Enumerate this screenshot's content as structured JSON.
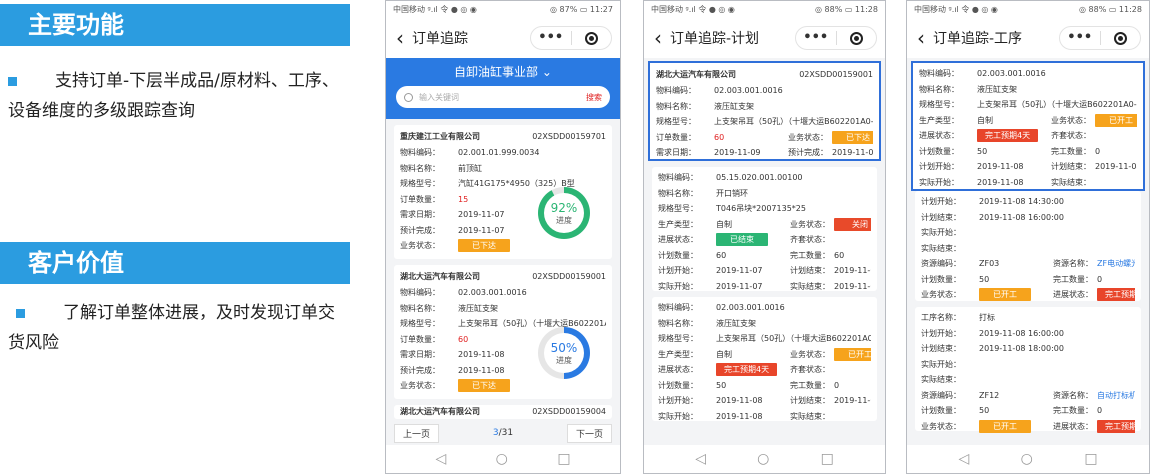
{
  "slide": {
    "title1": "主要功能",
    "text1": "支持订单-下层半成品/原材料、工序、设备维度的多级跟踪查询",
    "title2": "客户价值",
    "text2": "了解订单整体进展，及时发现订单交货风险"
  },
  "statusbar": {
    "carrier": "中国移动 ᵍ.ıl 令 ● ◎ ◉",
    "battery1": "◎ 87% ▭ 11:27",
    "battery2": "◎ 88% ▭ 11:28",
    "battery3": "◎ 88% ▭ 11:28"
  },
  "phone1": {
    "title": "订单追踪",
    "dept": "自卸油缸事业部",
    "search_placeholder": "输入关键词",
    "search_btn": "搜索",
    "cards": [
      {
        "company": "重庆建江工业有限公司",
        "code": "02XSDD00159701",
        "rows": [
          [
            "物料编码：",
            "02.001.01.999.0034"
          ],
          [
            "物料名称：",
            "前顶缸"
          ],
          [
            "规格型号：",
            "汽缸41G175*4950（325）B型"
          ],
          [
            "订单数量：",
            "15"
          ],
          [
            "需求日期：",
            "2019-11-07"
          ],
          [
            "预计完成：",
            "2019-11-07"
          ],
          [
            "业务状态：",
            "已下达"
          ]
        ],
        "pct": "92%",
        "pct_value": 92,
        "lbl": "进度",
        "color": "#2bb574"
      },
      {
        "company": "湖北大运汽车有限公司",
        "code": "02XSDD00159001",
        "rows": [
          [
            "物料编码：",
            "02.003.001.0016"
          ],
          [
            "物料名称：",
            "液压缸支架"
          ],
          [
            "规格型号：",
            "上支架吊耳（50孔）（十堰大运B602201A0-"
          ],
          [
            "订单数量：",
            "60"
          ],
          [
            "需求日期：",
            "2019-11-08"
          ],
          [
            "预计完成：",
            "2019-11-08"
          ],
          [
            "业务状态：",
            "已下达"
          ]
        ],
        "pct": "50%",
        "pct_value": 50,
        "lbl": "进度",
        "color": "#2a7ae2"
      }
    ],
    "card3_company": "湖北大运汽车有限公司",
    "card3_code": "02XSDD00159004",
    "prev": "上一页",
    "page_cur": "3",
    "page_total": "/31",
    "next": "下一页"
  },
  "phone2": {
    "title": "订单追踪-计划",
    "top": {
      "company": "湖北大运汽车有限公司",
      "code": "02XSDD00159001",
      "name_label": "物料编码：",
      "code_val": "02.003.001.0016",
      "mat_label": "物料名称：",
      "mat_val": "液压缸支架",
      "spec_label": "规格型号：",
      "spec_val": "上支架吊耳（50孔）（十堰大运B602201A0-",
      "qty_label": "订单数量：",
      "qty_val": "60",
      "biz_label": "业务状态：",
      "biz_val": "已下达",
      "req_label": "需求日期：",
      "req_val": "2019-11-09",
      "pred_label": "预计完成：",
      "pred_val": "2019-11-08"
    },
    "c2": {
      "code": "05.15.020.001.00100",
      "name": "开口销环",
      "spec": "T046吊块*2007135*25",
      "ptype": "自制",
      "biz": "关闭",
      "prog": "已结束",
      "st": "",
      "plan_qty": "60",
      "done_qty": "60",
      "plan_start": "2019-11-07",
      "plan_end": "2019-11-07",
      "act_start": "2019-11-07",
      "act_end": "2019-11-08"
    },
    "c3": {
      "code": "02.003.001.0016",
      "name": "液压缸支架",
      "spec": "上支架吊耳（50孔）（十堰大运B602201A0-",
      "ptype": "自制",
      "biz": "已开工",
      "prog": "完工预期4天",
      "st": "",
      "plan_qty": "50",
      "done_qty": "0",
      "plan_start": "2019-11-08",
      "plan_end": "2019-11-08",
      "act_start": "2019-11-08",
      "act_end": ""
    }
  },
  "phone3": {
    "title": "订单追踪-工序",
    "top": {
      "code": "02.003.001.0016",
      "name": "液压缸支架",
      "spec": "上支架吊耳（50孔）（十堰大运B602201A0-",
      "ptype": "自制",
      "biz": "已开工",
      "prog": "完工预期4天",
      "st": "",
      "plan_qty": "50",
      "done_qty": "0",
      "plan_start": "2019-11-08",
      "plan_end": "2019-11-08",
      "act_start": "2019-11-08",
      "act_end": ""
    },
    "p1": {
      "start": "2019-11-08 14:30:00",
      "end": "2019-11-08 16:00:00",
      "name": "",
      "qc": "",
      "code": "ZF03",
      "res": "ZF电动螺光机",
      "qty": "50",
      "done": "0",
      "biz": "已开工",
      "prog": "完工预期4天"
    },
    "p2": {
      "proc": "打标",
      "start": "2019-11-08 16:00:00",
      "end": "2019-11-08 18:00:00",
      "code": "ZF12",
      "res": "自动打标机",
      "qty": "50",
      "done": "0",
      "biz": "已开工",
      "prog": "完工预期4天"
    }
  }
}
